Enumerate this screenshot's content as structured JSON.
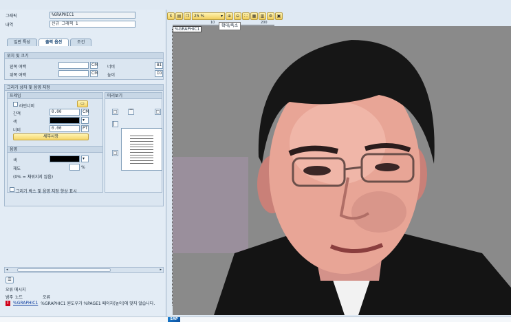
{
  "header": {
    "name_label": "그래픽",
    "name_value": "%GRAPHIC1",
    "desc_label": "내역",
    "desc_value": "신규 그래픽 1"
  },
  "tabs": [
    {
      "label": "일반 특성"
    },
    {
      "label": "출력 옵션"
    },
    {
      "label": "조건"
    }
  ],
  "position_group": {
    "title": "위치 및 크기",
    "left_margin_label": "왼쪽 여백",
    "left_margin_unit": "CM",
    "top_margin_label": "위쪽 여백",
    "top_margin_unit": "CM",
    "width_label": "너비",
    "width_unit": "BI",
    "height_label": "높이",
    "height_unit": "IOI"
  },
  "box_group": {
    "title": "그리기 상자 및 음영 지정",
    "frame_title": "프레임",
    "preview_title": "미리보기",
    "frame_check_label": "라인너비",
    "spacing_label": "간격",
    "spacing_value": "0.00",
    "spacing_unit": "CM",
    "color_label": "색",
    "width_label": "너비",
    "width_value": "0.00",
    "width_unit": "PT",
    "details_button": "세부사항",
    "shading_title": "음영",
    "shading_color_label": "색",
    "shading_percent_label": "채도",
    "shading_percent_unit": "%",
    "shading_note": "(0% = 채워지지 않음)",
    "always_show_label": "그리기 박스 및 음영 지정 항상 표시"
  },
  "messages": {
    "title": "오류 메시지",
    "col_type": "범주",
    "col_node": "노드",
    "col_error": "오류",
    "row_node": "%GRAPHIC1",
    "row_text": "%GRAPHIC1 원도우가 %PAGE1 페이지(높이)에 맞지 않습니다."
  },
  "toolbar": {
    "zoom_value": "25 %",
    "zoom_tooltip": "확대/축소"
  },
  "canvas": {
    "element_tag": "%GRAPHIC1"
  },
  "ruler": {
    "mark_1": "10",
    "mark_2": "200"
  },
  "status": {
    "logo": "SAP"
  },
  "colors": {
    "accent": "#0b3c6e",
    "error": "#d0021b",
    "button_yellow": "#f5d56a",
    "canvas_gray": "#808080"
  }
}
